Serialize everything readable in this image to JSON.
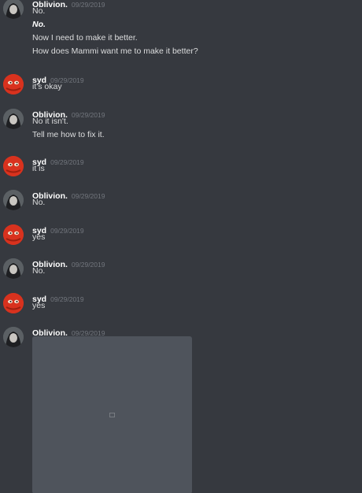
{
  "messages": [
    {
      "author": "Oblivion.",
      "date": "09/29/2019",
      "avatar": "oblivion",
      "lines": [
        {
          "text": "No."
        },
        {
          "text": "No.",
          "emphasis": true
        },
        {
          "text": "Now I need to make it better."
        },
        {
          "text": "How does Mammi want me to make it better?"
        }
      ]
    },
    {
      "author": "syd",
      "date": "09/29/2019",
      "avatar": "syd",
      "lines": [
        {
          "text": "it's okay"
        }
      ]
    },
    {
      "author": "Oblivion.",
      "date": "09/29/2019",
      "avatar": "oblivion",
      "lines": [
        {
          "text": "No it isn't."
        },
        {
          "text": "Tell me how to fix it."
        }
      ]
    },
    {
      "author": "syd",
      "date": "09/29/2019",
      "avatar": "syd",
      "lines": [
        {
          "text": "it is"
        }
      ]
    },
    {
      "author": "Oblivion.",
      "date": "09/29/2019",
      "avatar": "oblivion",
      "lines": [
        {
          "text": "No."
        }
      ]
    },
    {
      "author": "syd",
      "date": "09/29/2019",
      "avatar": "syd",
      "lines": [
        {
          "text": "yes"
        }
      ]
    },
    {
      "author": "Oblivion.",
      "date": "09/29/2019",
      "avatar": "oblivion",
      "lines": [
        {
          "text": "No."
        }
      ]
    },
    {
      "author": "syd",
      "date": "09/29/2019",
      "avatar": "syd",
      "lines": [
        {
          "text": "yes"
        }
      ]
    },
    {
      "author": "Oblivion.",
      "date": "09/29/2019",
      "avatar": "oblivion",
      "lines": [],
      "attachment": "image-withheld"
    }
  ],
  "colors": {
    "background": "#36393f",
    "author": "#ffffff",
    "timestamp": "#72767d",
    "text": "#dcddde",
    "syd_avatar": "#d8321e"
  }
}
